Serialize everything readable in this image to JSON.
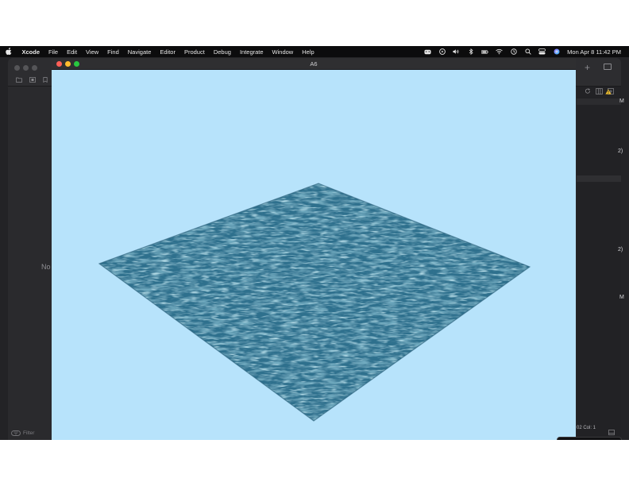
{
  "menubar": {
    "apple_icon": "apple-logo-icon",
    "app_name": "Xcode",
    "items": [
      "File",
      "Edit",
      "View",
      "Find",
      "Navigate",
      "Editor",
      "Product",
      "Debug",
      "Integrate",
      "Window",
      "Help"
    ],
    "status_icons": [
      "game-controller-icon",
      "play-circle-icon",
      "volume-icon",
      "bluetooth-icon",
      "battery-icon",
      "wifi-icon",
      "clock-icon",
      "search-icon",
      "control-center-icon",
      "siri-icon"
    ],
    "datetime": "Mon Apr 8  11:42 PM"
  },
  "xcode": {
    "navigator_placeholder": "No",
    "filter_label": "Filter",
    "right_panel_fragments": [
      "M",
      "2)",
      "2)",
      "M"
    ],
    "line_col": "02  Col: 1"
  },
  "simulator": {
    "title": "A6",
    "background_color": "#b7e3fb",
    "water_color": "#2f6f8d"
  }
}
